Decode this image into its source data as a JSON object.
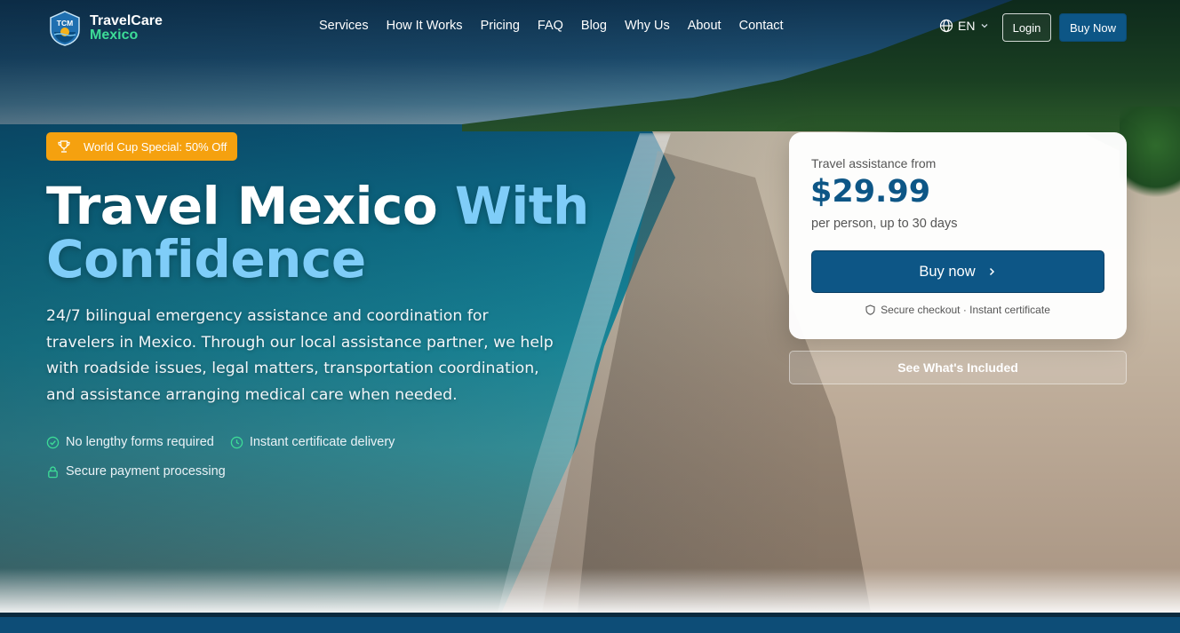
{
  "brand": {
    "badge_text": "TCM",
    "name_line1": "TravelCare",
    "name_line2": "Mexico",
    "accent_color": "#3ddc97"
  },
  "nav": {
    "items": [
      {
        "label": "Services"
      },
      {
        "label": "How It Works"
      },
      {
        "label": "Pricing"
      },
      {
        "label": "FAQ"
      },
      {
        "label": "Blog"
      },
      {
        "label": "Why Us"
      },
      {
        "label": "About"
      },
      {
        "label": "Contact"
      }
    ],
    "language": "EN",
    "login_label": "Login",
    "buy_label": "Buy Now",
    "primary_color": "#0d5686"
  },
  "hero": {
    "promo_label": "World Cup Special: 50% Off",
    "promo_color": "#f5a10f",
    "title_part1": "Travel Mexico ",
    "title_part2": "With Confidence",
    "title_accent_color": "#7fcdf8",
    "description": "24/7 bilingual emergency assistance and coordination for travelers in Mexico. Through our local assistance partner, we help with roadside issues, legal matters, transportation coordination, and assistance arranging medical care when needed.",
    "features": [
      {
        "icon": "check-circle-icon",
        "label": "No lengthy forms required"
      },
      {
        "icon": "clock-icon",
        "label": "Instant certificate delivery"
      },
      {
        "icon": "lock-icon",
        "label": "Secure payment processing"
      }
    ]
  },
  "pricing_card": {
    "from_label": "Travel assistance from",
    "price": "$29.99",
    "per_label": "per person, up to 30 days",
    "buy_label": "Buy now",
    "secure_label": "Secure checkout · Instant certificate"
  },
  "included_label": "See What's Included"
}
